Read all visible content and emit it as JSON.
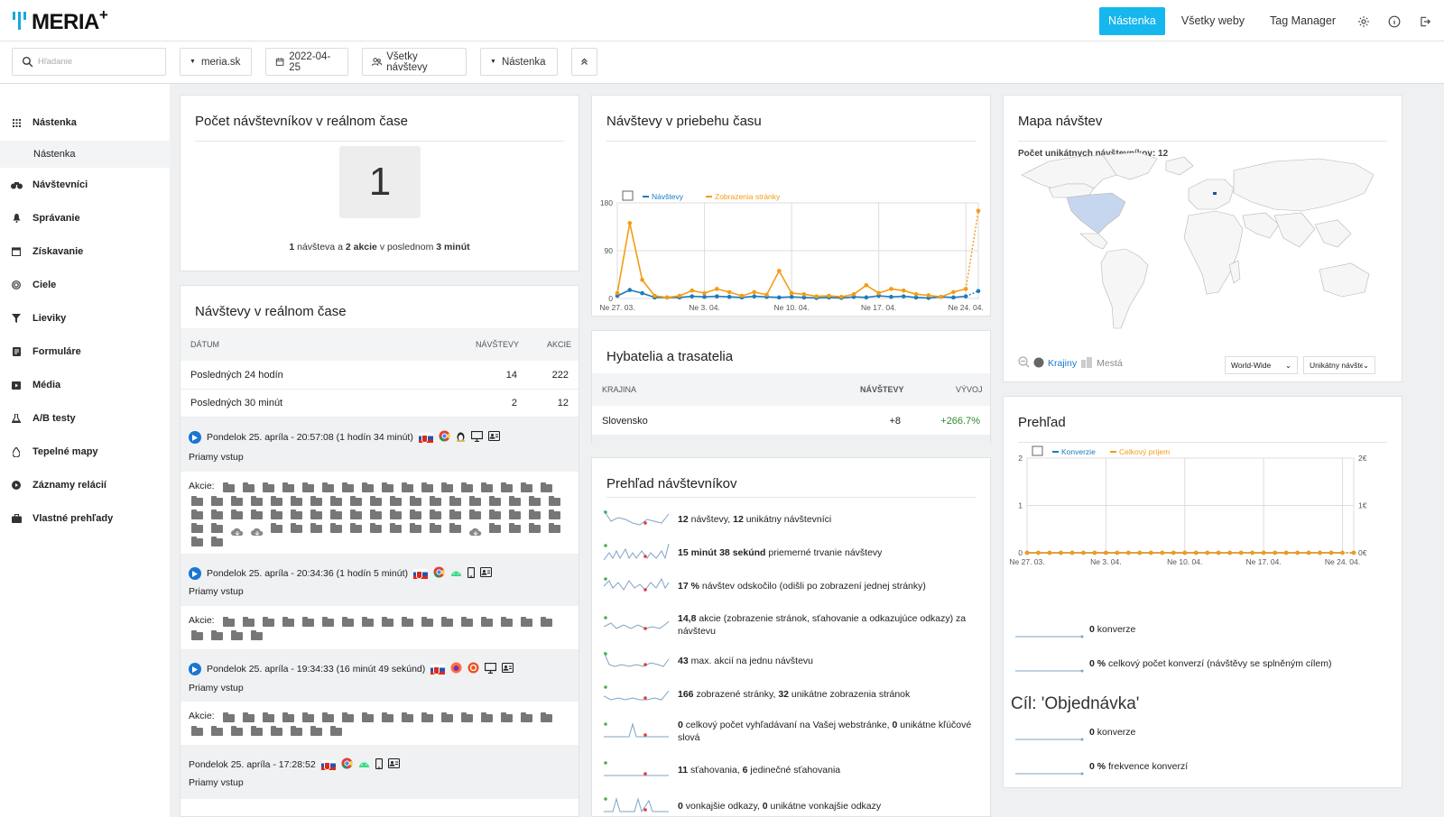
{
  "brand": {
    "logo_text": "MERIA"
  },
  "topnav": {
    "items": [
      "Nástenka",
      "Všetky weby",
      "Tag Manager"
    ],
    "active_color": "#16b6ee"
  },
  "filters": {
    "search_placeholder": "Hľadanie",
    "site": "meria.sk",
    "date": "2022-04-25",
    "segment": "Všetky návštevy",
    "dashboard": "Nástenka"
  },
  "sidebar": {
    "items": [
      {
        "label": "Nástenka",
        "icon": "grid-icon"
      },
      {
        "label": "Nástenka",
        "icon": ""
      },
      {
        "label": "Návštevníci",
        "icon": "binoculars-icon"
      },
      {
        "label": "Správanie",
        "icon": "bell-icon"
      },
      {
        "label": "Získavanie",
        "icon": "calendar-icon"
      },
      {
        "label": "Ciele",
        "icon": "target-icon"
      },
      {
        "label": "Lieviky",
        "icon": "funnel-icon"
      },
      {
        "label": "Formuláre",
        "icon": "form-icon"
      },
      {
        "label": "Média",
        "icon": "media-icon"
      },
      {
        "label": "A/B testy",
        "icon": "flask-icon"
      },
      {
        "label": "Tepelné mapy",
        "icon": "drop-icon"
      },
      {
        "label": "Záznamy relácií",
        "icon": "play-circle-icon"
      },
      {
        "label": "Vlastné prehľady",
        "icon": "briefcase-icon"
      }
    ]
  },
  "realtime_counter": {
    "title": "Počet návštevníkov v reálnom čase",
    "count": "1",
    "summary": {
      "visits": "1",
      "w_visit": "návšteva",
      "w_and": "a",
      "actions": "2",
      "w_actions": "akcie",
      "w_in": "v poslednom",
      "minutes": "3 minút"
    }
  },
  "realtime_visits": {
    "title": "Návštevy v reálnom čase",
    "headers": [
      "DÁTUM",
      "NÁVŠTEVY",
      "AKCIE"
    ],
    "rows": [
      {
        "date": "Posledných 24 hodín",
        "visits": "14",
        "actions": "222"
      },
      {
        "date": "Posledných 30 minút",
        "visits": "2",
        "actions": "12"
      }
    ],
    "visits": [
      {
        "time": "Pondelok 25. apríla - 20:57:08 (1 hodín 34 minút)",
        "source": "Priamy vstup",
        "actions_label": "Akcie:"
      },
      {
        "time": "Pondelok 25. apríla - 20:34:36 (1 hodín 5 minút)",
        "source": "Priamy vstup",
        "actions_label": "Akcie:"
      },
      {
        "time": "Pondelok 25. apríla - 19:34:33 (16 minút 49 sekúnd)",
        "source": "Priamy vstup",
        "actions_label": "Akcie:"
      },
      {
        "time": "Pondelok 25. apríla - 17:28:52",
        "source": "Priamy vstup",
        "actions_label": ""
      }
    ]
  },
  "visits_over_time": {
    "title": "Návštevy v priebehu času",
    "chart_data": {
      "type": "line",
      "categories": [
        "Ne 27. 03.",
        "28",
        "29",
        "30",
        "31",
        "1",
        "2",
        "Ne 3. 04.",
        "4",
        "5",
        "6",
        "7",
        "8",
        "9",
        "Ne 10. 04.",
        "11",
        "12",
        "13",
        "14",
        "15",
        "16",
        "Ne 17. 04.",
        "18",
        "19",
        "20",
        "21",
        "22",
        "23",
        "Ne 24. 04.",
        "25"
      ],
      "x_ticks": [
        "Ne 27. 03.",
        "Ne 3. 04.",
        "Ne 10. 04.",
        "Ne 17. 04.",
        "Ne 24. 04."
      ],
      "ylim": [
        0,
        180
      ],
      "y_ticks": [
        "0",
        "90",
        "180"
      ],
      "series": [
        {
          "name": "Návštevy",
          "color": "#1a7bbf",
          "values": [
            5,
            16,
            10,
            2,
            2,
            2,
            4,
            3,
            4,
            3,
            2,
            4,
            3,
            2,
            3,
            2,
            1,
            2,
            1,
            3,
            2,
            5,
            3,
            4,
            2,
            1,
            3,
            2,
            4,
            14
          ]
        },
        {
          "name": "Zobrazenia stránky",
          "color": "#f39c12",
          "values": [
            10,
            142,
            35,
            5,
            2,
            5,
            15,
            10,
            18,
            12,
            5,
            12,
            7,
            52,
            10,
            8,
            4,
            5,
            3,
            8,
            25,
            10,
            18,
            15,
            8,
            6,
            3,
            12,
            18,
            165
          ]
        }
      ]
    }
  },
  "movers": {
    "title": "Hybatelia a trasatelia",
    "headers": [
      "KRAJINA",
      "NÁVŠTEVY",
      "VÝVOJ"
    ],
    "rows": [
      {
        "country": "Slovensko",
        "visits": "+8",
        "change": "+266.7%"
      }
    ]
  },
  "visitor_overview": {
    "title": "Prehľad návštevníkov",
    "items": [
      {
        "bold": "12",
        "text": " návštevy, ",
        "bold2": "12",
        "text2": " unikátny návštevníci"
      },
      {
        "bold": "15 minút 38 sekúnd",
        "text": " priemerné trvanie návštevy",
        "bold2": "",
        "text2": ""
      },
      {
        "bold": "17 %",
        "text": " návštev odskočilo (odišli po zobrazení jednej stránky)",
        "bold2": "",
        "text2": ""
      },
      {
        "bold": "14,8",
        "text": " akcie (zobrazenie stránok, sťahovanie a odkazujúce odkazy) za návštevu",
        "bold2": "",
        "text2": ""
      },
      {
        "bold": "43",
        "text": " max. akcií na jednu návštevu",
        "bold2": "",
        "text2": ""
      },
      {
        "bold": "166",
        "text": " zobrazené stránky, ",
        "bold2": "32",
        "text2": " unikátne zobrazenia stránok"
      },
      {
        "bold": "0",
        "text": " celkový počet vyhľadávaní na Vašej webstránke, ",
        "bold2": "0",
        "text2": " unikátne kľúčové slová"
      },
      {
        "bold": "11",
        "text": " sťahovania, ",
        "bold2": "6",
        "text2": " jedinečné sťahovania"
      },
      {
        "bold": "0",
        "text": " vonkajšie odkazy, ",
        "bold2": "0",
        "text2": " unikátne vonkajšie odkazy"
      }
    ]
  },
  "visitor_map": {
    "title": "Mapa návštev",
    "unique_label": "Počet unikátnych návštevníkov: 12",
    "tab_countries": "Krajiny",
    "tab_cities": "Mestá",
    "region_select": "World-Wide",
    "metric_select": "Unikátny návštev",
    "highlight_color": "#c7d6ef"
  },
  "goals_overview": {
    "title": "Prehľad",
    "chart_data": {
      "type": "line",
      "categories": [
        "Ne 27. 03.",
        "28",
        "29",
        "30",
        "31",
        "1",
        "2",
        "Ne 3. 04.",
        "4",
        "5",
        "6",
        "7",
        "8",
        "9",
        "Ne 10. 04.",
        "11",
        "12",
        "13",
        "14",
        "15",
        "16",
        "Ne 17. 04.",
        "18",
        "19",
        "20",
        "21",
        "22",
        "23",
        "Ne 24. 04.",
        "25"
      ],
      "x_ticks": [
        "Ne 27. 03.",
        "Ne 3. 04.",
        "Ne 10. 04.",
        "Ne 17. 04.",
        "Ne 24. 04."
      ],
      "ylim": [
        0,
        2
      ],
      "y_ticks": [
        "0",
        "1",
        "2"
      ],
      "y2_ticks": [
        "0€",
        "1€",
        "2€"
      ],
      "series": [
        {
          "name": "Konverzie",
          "color": "#1a7bbf",
          "values": [
            0,
            0,
            0,
            0,
            0,
            0,
            0,
            0,
            0,
            0,
            0,
            0,
            0,
            0,
            0,
            0,
            0,
            0,
            0,
            0,
            0,
            0,
            0,
            0,
            0,
            0,
            0,
            0,
            0,
            0
          ]
        },
        {
          "name": "Celkový príjem",
          "color": "#f39c12",
          "values": [
            0,
            0,
            0,
            0,
            0,
            0,
            0,
            0,
            0,
            0,
            0,
            0,
            0,
            0,
            0,
            0,
            0,
            0,
            0,
            0,
            0,
            0,
            0,
            0,
            0,
            0,
            0,
            0,
            0,
            0
          ]
        }
      ]
    },
    "summary": [
      {
        "bold": "0",
        "text": " konverze"
      },
      {
        "bold": "0 %",
        "text": " celkový počet konverzí (návštěvy se splněným cílem)"
      }
    ],
    "goal_title": "Cíl: 'Objednávka'",
    "goal_summary": [
      {
        "bold": "0",
        "text": " konverze"
      },
      {
        "bold": "0 %",
        "text": " frekvence konverzí"
      }
    ]
  }
}
